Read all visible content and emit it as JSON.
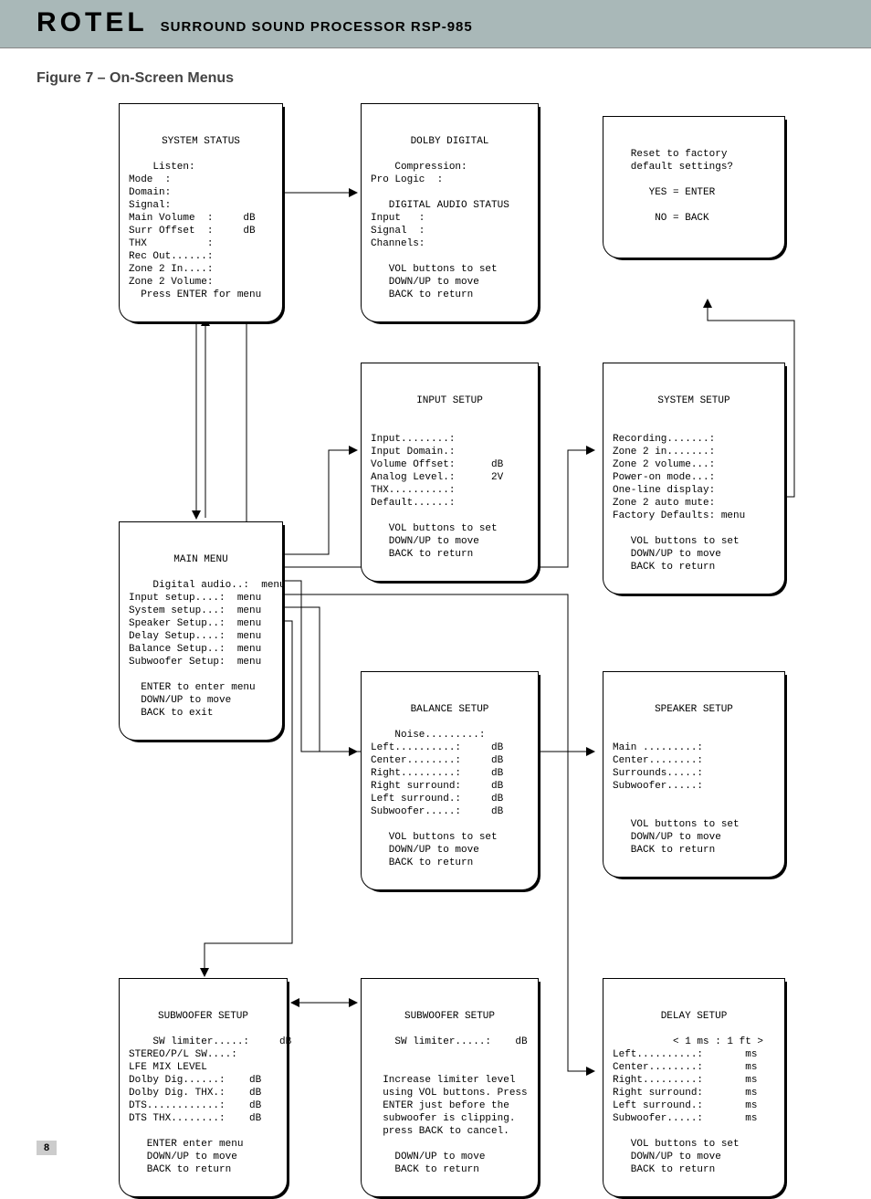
{
  "header": {
    "brand": "ROTEL",
    "subtitle": "SURROUND SOUND PROCESSOR  RSP-985"
  },
  "figure_title": "Figure 7 – On-Screen Menus",
  "page_number": "8",
  "menus": {
    "system_status": {
      "title": "SYSTEM STATUS",
      "body": "Listen:\nMode  :\nDomain:\nSignal:\nMain Volume  :     dB\nSurr Offset  :     dB\nTHX          :\nRec Out......:\nZone 2 In....:\nZone 2 Volume:\n  Press ENTER for menu"
    },
    "dolby_digital": {
      "title": "DOLBY DIGITAL",
      "body": "Compression:\nPro Logic  :\n\n   DIGITAL AUDIO STATUS\nInput   :\nSignal  :\nChannels:\n\n   VOL buttons to set\n   DOWN/UP to move\n   BACK to return"
    },
    "reset": {
      "body": "\n   Reset to factory\n   default settings?\n\n      YES = ENTER\n\n       NO = BACK\n"
    },
    "input_setup": {
      "title": "INPUT SETUP",
      "body": "\nInput........:\nInput Domain.:\nVolume Offset:      dB\nAnalog Level.:      2V\nTHX..........:\nDefault......:\n\n   VOL buttons to set\n   DOWN/UP to move\n   BACK to return"
    },
    "system_setup": {
      "title": "SYSTEM SETUP",
      "body": "\nRecording.......:\nZone 2 in.......:\nZone 2 volume...:\nPower-on mode...:\nOne-line display:\nZone 2 auto mute:\nFactory Defaults: menu\n\n   VOL buttons to set\n   DOWN/UP to move\n   BACK to return"
    },
    "main_menu": {
      "title": "MAIN MENU",
      "body": "Digital audio..:  menu\nInput setup....:  menu\nSystem setup...:  menu\nSpeaker Setup..:  menu\nDelay Setup....:  menu\nBalance Setup..:  menu\nSubwoofer Setup:  menu\n\n  ENTER to enter menu\n  DOWN/UP to move\n  BACK to exit"
    },
    "balance_setup": {
      "title": "BALANCE SETUP",
      "body": "Noise.........:\nLeft..........:     dB\nCenter........:     dB\nRight.........:     dB\nRight surround:     dB\nLeft surround.:     dB\nSubwoofer.....:     dB\n\n   VOL buttons to set\n   DOWN/UP to move\n   BACK to return"
    },
    "speaker_setup": {
      "title": "SPEAKER SETUP",
      "body": "\nMain .........:\nCenter........:\nSurrounds.....:\nSubwoofer.....:\n\n\n   VOL buttons to set\n   DOWN/UP to move\n   BACK to return"
    },
    "subwoofer_setup_a": {
      "title": "SUBWOOFER SETUP",
      "body": "SW limiter.....:     dB\nSTEREO/P/L SW....:\nLFE MIX LEVEL\nDolby Dig......:    dB\nDolby Dig. THX.:    dB\nDTS............:    dB\nDTS THX........:    dB\n\n   ENTER enter menu\n   DOWN/UP to move\n   BACK to return"
    },
    "subwoofer_setup_b": {
      "title": "SUBWOOFER SETUP",
      "body": "SW limiter.....:    dB\n\n\n  Increase limiter level\n  using VOL buttons. Press\n  ENTER just before the\n  subwoofer is clipping.\n  press BACK to cancel.\n\n    DOWN/UP to move\n    BACK to return"
    },
    "delay_setup": {
      "title": "DELAY SETUP",
      "body": "      < 1 ms : 1 ft >\nLeft..........:       ms\nCenter........:       ms\nRight.........:       ms\nRight surround:       ms\nLeft surround.:       ms\nSubwoofer.....:       ms\n\n   VOL buttons to set\n   DOWN/UP to move\n   BACK to return"
    }
  }
}
